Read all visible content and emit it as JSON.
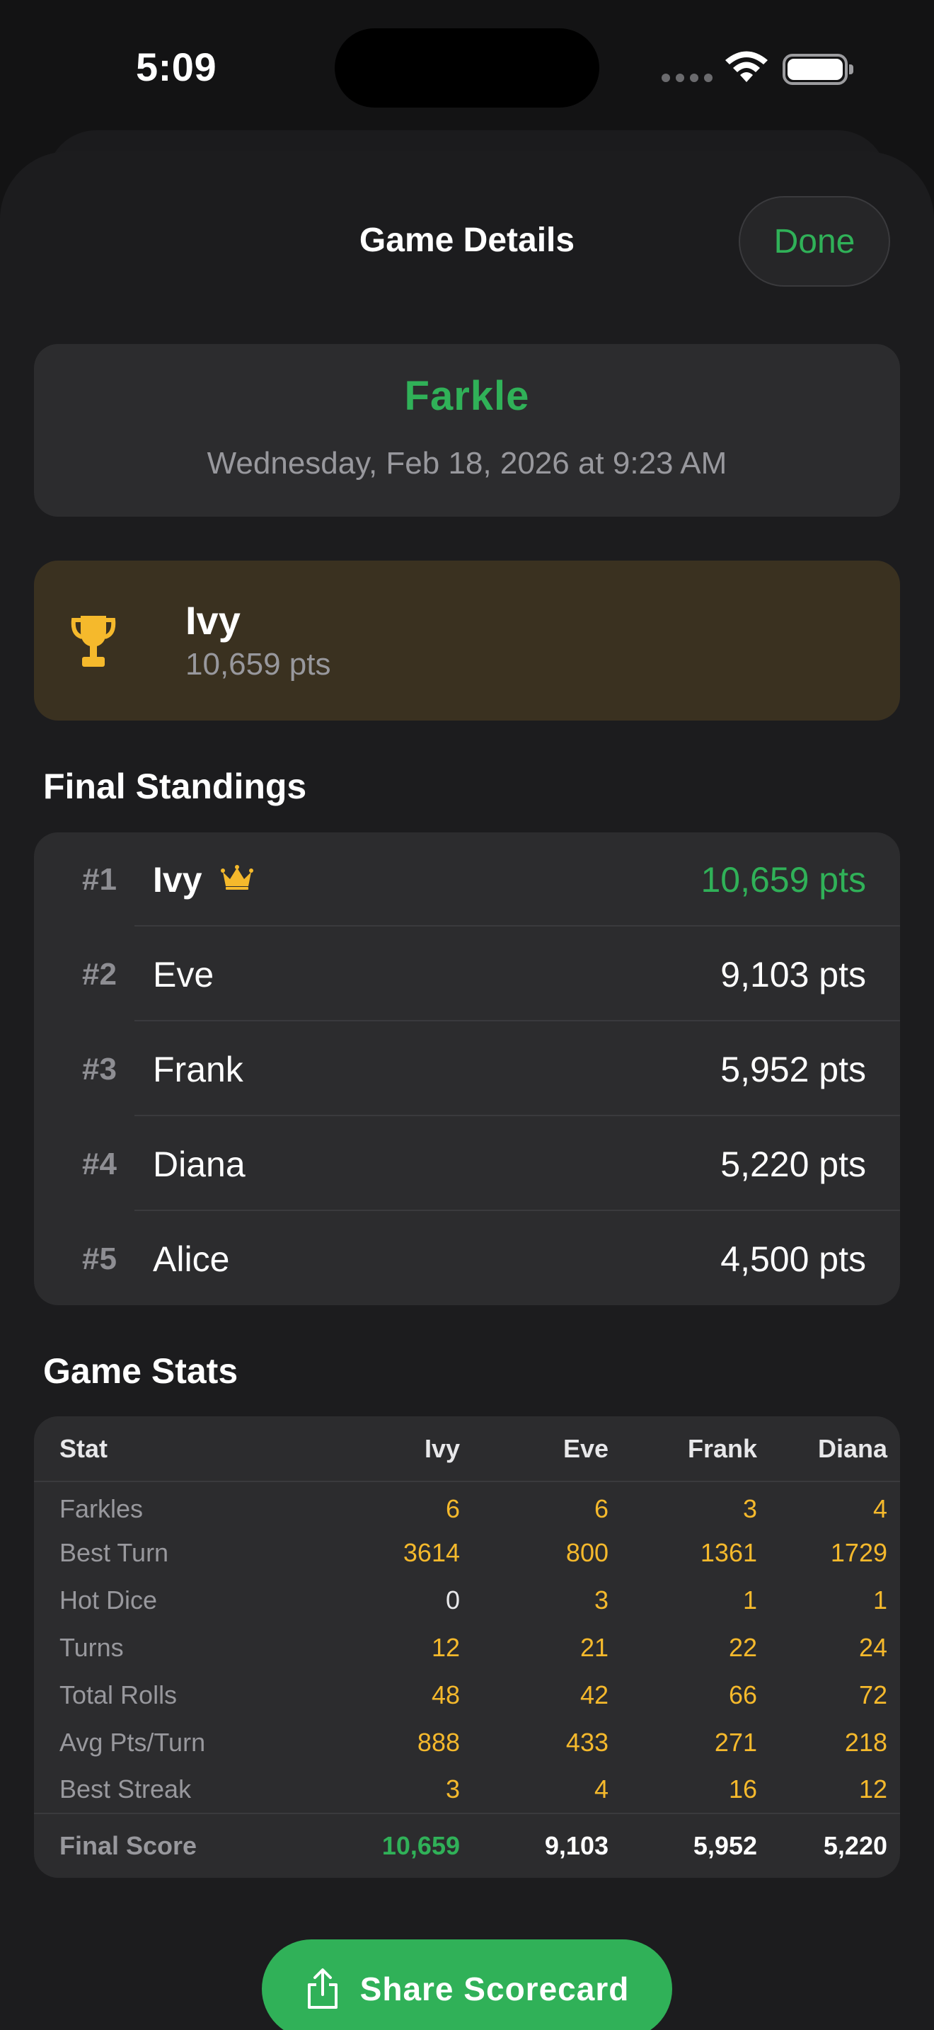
{
  "status": {
    "time": "5:09"
  },
  "sheet": {
    "title": "Game Details",
    "done_label": "Done"
  },
  "game": {
    "name": "Farkle",
    "date": "Wednesday, Feb 18, 2026 at 9:23 AM"
  },
  "winner": {
    "name": "Ivy",
    "points": "10,659 pts"
  },
  "standings": {
    "title": "Final Standings",
    "rows": [
      {
        "rank": "#1",
        "name": "Ivy",
        "points": "10,659 pts"
      },
      {
        "rank": "#2",
        "name": "Eve",
        "points": "9,103 pts"
      },
      {
        "rank": "#3",
        "name": "Frank",
        "points": "5,952 pts"
      },
      {
        "rank": "#4",
        "name": "Diana",
        "points": "5,220 pts"
      },
      {
        "rank": "#5",
        "name": "Alice",
        "points": "4,500 pts"
      }
    ]
  },
  "stats": {
    "title": "Game Stats",
    "headers": [
      "Stat",
      "Ivy",
      "Eve",
      "Frank",
      "Diana"
    ],
    "rows": [
      {
        "label": "Farkles",
        "values": [
          "6",
          "6",
          "3",
          "4"
        ]
      },
      {
        "label": "Best Turn",
        "values": [
          "3614",
          "800",
          "1361",
          "1729"
        ]
      },
      {
        "label": "Hot Dice",
        "values": [
          "0",
          "3",
          "1",
          "1"
        ]
      },
      {
        "label": "Turns",
        "values": [
          "12",
          "21",
          "22",
          "24"
        ]
      },
      {
        "label": "Total Rolls",
        "values": [
          "48",
          "42",
          "66",
          "72"
        ]
      },
      {
        "label": "Avg Pts/Turn",
        "values": [
          "888",
          "433",
          "271",
          "218"
        ]
      },
      {
        "label": "Best Streak",
        "values": [
          "3",
          "4",
          "16",
          "12"
        ]
      }
    ],
    "final": {
      "label": "Final Score",
      "values": [
        "10,659",
        "9,103",
        "5,952",
        "5,220"
      ]
    }
  },
  "share": {
    "label": "Share Scorecard"
  },
  "colors": {
    "accent": "#30b158",
    "gold": "#f5b92c",
    "winner_bg": "#3a3120"
  }
}
